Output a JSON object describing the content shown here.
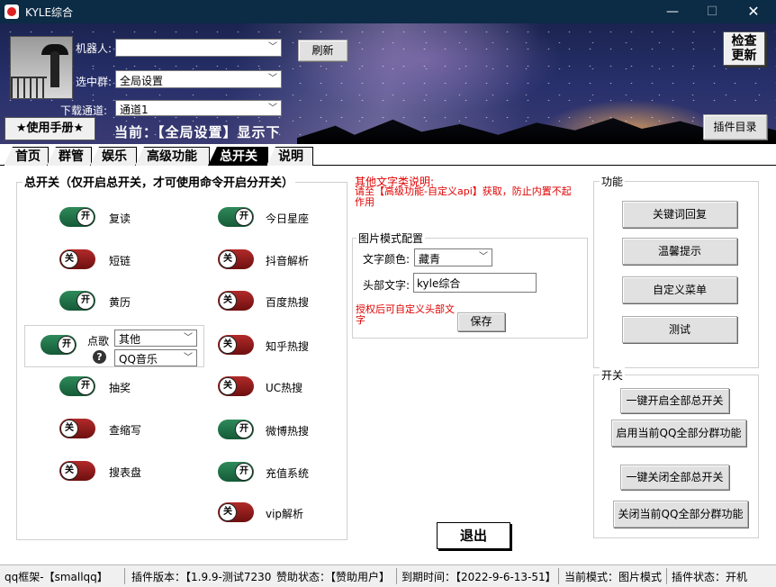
{
  "window": {
    "title": "KYLE综合"
  },
  "header": {
    "robot_label": "机器人:",
    "robot_value": "",
    "group_label": "选中群:",
    "group_value": "全局设置",
    "channel_label": "下载通道:",
    "channel_value": "通道1",
    "refresh_label": "刷新",
    "manual_label": "★使用手册★",
    "current_scope": "当前：【全局设置】显示下",
    "check_update_label": "检查更新",
    "plugin_dir_label": "插件目录"
  },
  "tabs": [
    {
      "label": "首页",
      "active": false
    },
    {
      "label": "群管",
      "active": false
    },
    {
      "label": "娱乐",
      "active": false
    },
    {
      "label": "高级功能",
      "active": false
    },
    {
      "label": "总开关",
      "active": true
    },
    {
      "label": "说明",
      "active": false
    }
  ],
  "switches": {
    "title": "总开关（仅开启总开关，才可使用命令开启分开关）",
    "left": [
      {
        "label": "复读",
        "on": true,
        "knob": "开"
      },
      {
        "label": "短链",
        "on": false,
        "knob": "关"
      },
      {
        "label": "黄历",
        "on": true,
        "knob": "开"
      },
      {
        "label": "抽奖",
        "on": true,
        "knob": "开"
      },
      {
        "label": "查缩写",
        "on": false,
        "knob": "关"
      },
      {
        "label": "搜表盘",
        "on": false,
        "knob": "关"
      }
    ],
    "song": {
      "label": "点歌",
      "on": true,
      "knob": "开",
      "select1": "其他",
      "select2": "QQ音乐",
      "help": "?"
    },
    "right": [
      {
        "label": "今日星座",
        "on": true,
        "knob": "开"
      },
      {
        "label": "抖音解析",
        "on": false,
        "knob": "关"
      },
      {
        "label": "百度热搜",
        "on": false,
        "knob": "关"
      },
      {
        "label": "知乎热搜",
        "on": false,
        "knob": "关"
      },
      {
        "label": "UC热搜",
        "on": false,
        "knob": "关"
      },
      {
        "label": "微博热搜",
        "on": true,
        "knob": "开"
      },
      {
        "label": "充值系统",
        "on": true,
        "knob": "开"
      },
      {
        "label": "vip解析",
        "on": false,
        "knob": "关"
      }
    ]
  },
  "middle": {
    "note_title": "其他文字类说明:",
    "note_body": "请至【高级功能-自定义api】获取，防止内置不起作用",
    "image_group_title": "图片模式配置",
    "text_color_label": "文字颜色:",
    "text_color_value": "藏青",
    "header_text_label": "头部文字:",
    "header_text_value": "kyle综合",
    "auth_note": "授权后可自定义头部文字",
    "save_label": "保存",
    "exit_label": "退出"
  },
  "functions": {
    "title": "功能",
    "buttons": [
      "关键词回复",
      "温馨提示",
      "自定义菜单",
      "测试"
    ]
  },
  "switch_panel": {
    "title": "开关",
    "buttons": [
      "一键开启全部总开关",
      "启用当前QQ全部分群功能",
      "一键关闭全部总开关",
      "关闭当前QQ全部分群功能"
    ]
  },
  "status": {
    "framework": "qq框架-【smallqq】",
    "plugin_version": "插件版本：【1.9.9-测试7230",
    "sponsor": "赞助状态：【赞助用户】",
    "expiry": "到期时间：【2022-9-6-13-51】",
    "mode": "当前模式：图片模式",
    "plugin_state": "插件状态：开机"
  },
  "colors": {
    "titlebar": "#0c2b45",
    "switch_on": "#1f6f45",
    "switch_off": "#8e1a1a",
    "note_red": "#e00000"
  }
}
